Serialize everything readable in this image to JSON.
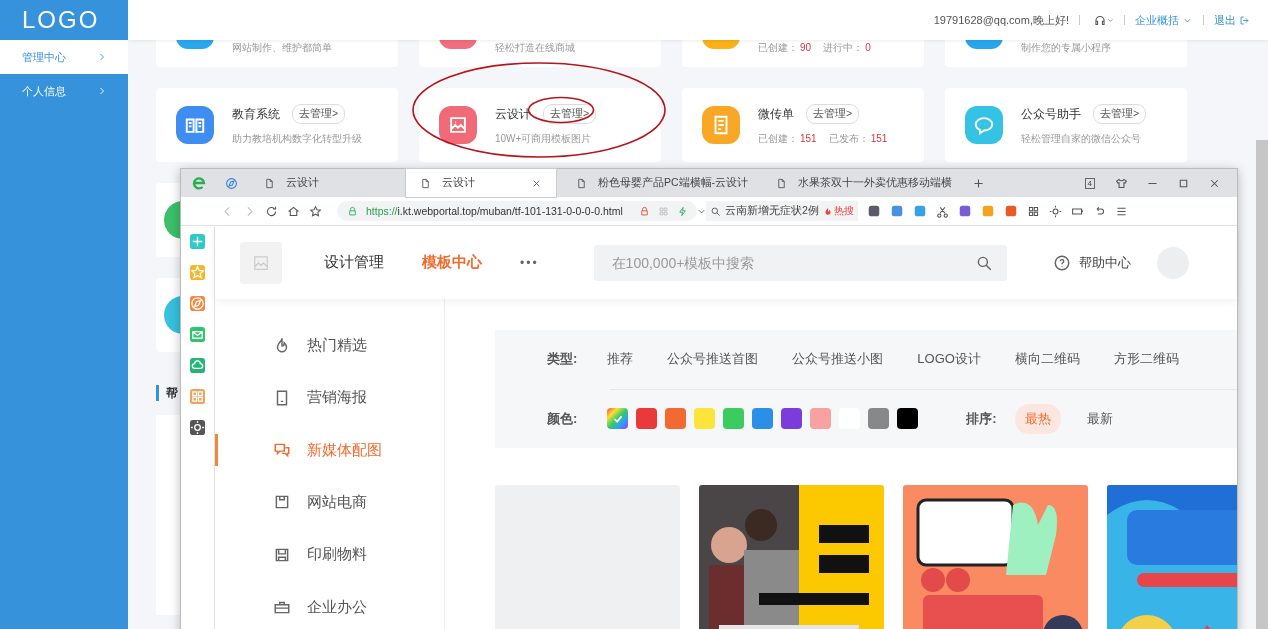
{
  "sidebar": {
    "logo": "LOGO",
    "items": [
      {
        "label": "管理中心",
        "selected": true
      },
      {
        "label": "个人信息",
        "selected": false
      }
    ]
  },
  "header": {
    "greeting": "19791628@qq.com,晚上好!",
    "menu": "企业概括",
    "logout": "退出"
  },
  "cards": [
    {
      "color": "#29a8f0",
      "desc": "网站制作、维护都简单"
    },
    {
      "color": "#f26d7d",
      "desc": "轻松打造在线商城"
    },
    {
      "color": "#fbb117",
      "stats": [
        {
          "label": "已创建：",
          "value": "90"
        },
        {
          "label": "进行中：",
          "value": "0"
        }
      ]
    },
    {
      "color": "#27a6ef",
      "desc": "制作您的专属小程序"
    },
    {
      "color": "#3d8ef0",
      "title": "教育系统",
      "action": "去管理>",
      "desc": "助力教培机构数字化转型升级",
      "highlighted": false
    },
    {
      "color": "#f06a78",
      "title": "云设计",
      "action": "去管理>",
      "desc": "10W+可商用模板图片",
      "highlighted": true
    },
    {
      "color": "#f9a825",
      "title": "微传单",
      "action": "去管理>",
      "stats": [
        {
          "label": "已创建：",
          "value": "151"
        },
        {
          "label": "已发布：",
          "value": "151"
        }
      ],
      "highlighted": false
    },
    {
      "color": "#35c3e5",
      "title": "公众号助手",
      "action": "去管理>",
      "desc": "轻松管理自家的微信公众号",
      "highlighted": false
    }
  ],
  "more_cards": [
    {
      "color": "#3bbf6a"
    },
    {
      "color": "#36c1df"
    }
  ],
  "help": {
    "title": "帮"
  },
  "browser": {
    "tabs": [
      {
        "title": "云设计",
        "selected": false
      },
      {
        "title": "云设计",
        "selected": true
      },
      {
        "title": "粉色母婴产品PC端横幅-云设计",
        "selected": false
      },
      {
        "title": "水果茶双十一外卖优惠移动端横",
        "selected": false
      }
    ],
    "tab_count": "4",
    "url_scheme": "https://",
    "url_rest": "i.kt.webportal.top/muban/tf-101-131-0-0-0-0.html",
    "search": "云南新增无症状2例",
    "hot": "热搜"
  },
  "site": {
    "nav": [
      {
        "label": "设计管理",
        "selected": false
      },
      {
        "label": "模板中心",
        "selected": true
      }
    ],
    "more": "•••",
    "search_placeholder": "在100,000+模板中搜索",
    "help": "帮助中心",
    "menu": [
      {
        "label": "热门精选",
        "selected": false
      },
      {
        "label": "营销海报",
        "selected": false
      },
      {
        "label": "新媒体配图",
        "selected": true
      },
      {
        "label": "网站电商",
        "selected": false
      },
      {
        "label": "印刷物料",
        "selected": false
      },
      {
        "label": "企业办公",
        "selected": false
      }
    ],
    "type_label": "类型:",
    "types": [
      "推荐",
      "公众号推送首图",
      "公众号推送小图",
      "LOGO设计",
      "横向二维码",
      "方形二维码"
    ],
    "color_label": "颜色:",
    "colors": [
      {
        "kind": "all",
        "selected": true
      },
      {
        "kind": "swatch",
        "color": "#e93a3a",
        "selected": false
      },
      {
        "kind": "swatch",
        "color": "#f26a32",
        "selected": false
      },
      {
        "kind": "swatch",
        "color": "#fce43a",
        "selected": false
      },
      {
        "kind": "swatch",
        "color": "#3ccb5f",
        "selected": false
      },
      {
        "kind": "swatch",
        "color": "#2b8fe8",
        "selected": false
      },
      {
        "kind": "swatch",
        "color": "#7c3cdb",
        "selected": false
      },
      {
        "kind": "swatch",
        "color": "#f7a1a1",
        "selected": false
      },
      {
        "kind": "swatch",
        "color": "#ffffff",
        "selected": false
      },
      {
        "kind": "swatch",
        "color": "#888888",
        "selected": false
      },
      {
        "kind": "swatch",
        "color": "#000000",
        "selected": false
      }
    ],
    "sort_label": "排序:",
    "sorts": [
      {
        "label": "最热",
        "selected": true
      },
      {
        "label": "最新",
        "selected": false
      }
    ],
    "templates": [
      {
        "kind": "placeholder"
      },
      {
        "kind": "picture"
      },
      {
        "kind": "picture"
      },
      {
        "kind": "picture"
      }
    ]
  }
}
